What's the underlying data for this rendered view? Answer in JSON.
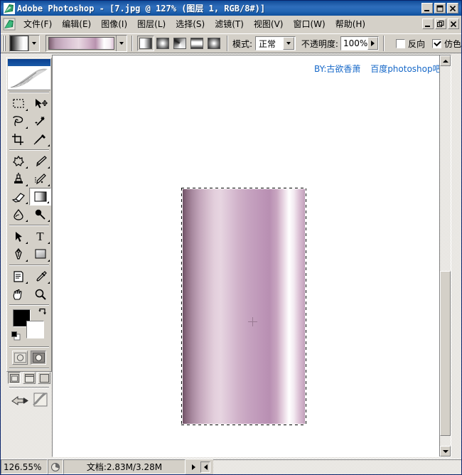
{
  "window": {
    "app_name": "Adobe Photoshop",
    "title": "Adobe Photoshop - [7.jpg @ 127% (图层 1, RGB/8#)]",
    "document_name": "7.jpg",
    "document_zoom_label": "127%",
    "layer_label": "图层 1",
    "color_mode_label": "RGB/8#",
    "app_icon": "photoshop-feather-icon",
    "controls": {
      "minimize": "_",
      "restore": "❐",
      "close": "✕"
    },
    "mdi_controls": {
      "minimize": "_",
      "restore": "❐",
      "close": "✕"
    }
  },
  "menubar": {
    "items": [
      {
        "label": "文件(F)",
        "name": "menu-file"
      },
      {
        "label": "编辑(E)",
        "name": "menu-edit"
      },
      {
        "label": "图像(I)",
        "name": "menu-image"
      },
      {
        "label": "图层(L)",
        "name": "menu-layer"
      },
      {
        "label": "选择(S)",
        "name": "menu-select"
      },
      {
        "label": "滤镜(T)",
        "name": "menu-filter"
      },
      {
        "label": "视图(V)",
        "name": "menu-view"
      },
      {
        "label": "窗口(W)",
        "name": "menu-window"
      },
      {
        "label": "帮助(H)",
        "name": "menu-help"
      }
    ]
  },
  "options_bar": {
    "tool_preset_name": "gradient-tool-preset",
    "gradient_preset_name": "pink-white-gradient",
    "gradient_types": [
      {
        "name": "linear-gradient-button",
        "selected": true
      },
      {
        "name": "radial-gradient-button",
        "selected": false
      },
      {
        "name": "angle-gradient-button",
        "selected": false
      },
      {
        "name": "reflected-gradient-button",
        "selected": false
      },
      {
        "name": "diamond-gradient-button",
        "selected": false
      }
    ],
    "mode_label": "模式:",
    "mode_value": "正常",
    "opacity_label": "不透明度:",
    "opacity_value": "100%",
    "reverse_label": "反向",
    "reverse_checked": false,
    "dither_label": "仿色",
    "dither_checked": true
  },
  "toolbox": {
    "tools": [
      {
        "name": "rectangular-marquee-tool",
        "icon": "marquee-icon",
        "selected": false,
        "has_flyout": true
      },
      {
        "name": "move-tool",
        "icon": "move-icon",
        "selected": false,
        "has_flyout": false
      },
      {
        "name": "lasso-tool",
        "icon": "lasso-icon",
        "selected": false,
        "has_flyout": true
      },
      {
        "name": "magic-wand-tool",
        "icon": "magic-wand-icon",
        "selected": false,
        "has_flyout": false
      },
      {
        "name": "crop-tool",
        "icon": "crop-icon",
        "selected": false,
        "has_flyout": false
      },
      {
        "name": "slice-tool",
        "icon": "slice-icon",
        "selected": false,
        "has_flyout": true
      },
      {
        "name": "healing-brush-tool",
        "icon": "healing-brush-icon",
        "selected": false,
        "has_flyout": true
      },
      {
        "name": "brush-tool",
        "icon": "brush-icon",
        "selected": false,
        "has_flyout": true
      },
      {
        "name": "clone-stamp-tool",
        "icon": "stamp-icon",
        "selected": false,
        "has_flyout": true
      },
      {
        "name": "history-brush-tool",
        "icon": "history-brush-icon",
        "selected": false,
        "has_flyout": true
      },
      {
        "name": "eraser-tool",
        "icon": "eraser-icon",
        "selected": false,
        "has_flyout": true
      },
      {
        "name": "gradient-tool",
        "icon": "gradient-icon",
        "selected": true,
        "has_flyout": true
      },
      {
        "name": "blur-tool",
        "icon": "blur-drop-icon",
        "selected": false,
        "has_flyout": true
      },
      {
        "name": "dodge-tool",
        "icon": "dodge-icon",
        "selected": false,
        "has_flyout": true
      },
      {
        "name": "path-selection-tool",
        "icon": "path-arrow-icon",
        "selected": false,
        "has_flyout": true
      },
      {
        "name": "type-tool",
        "icon": "type-t-icon",
        "selected": false,
        "has_flyout": true
      },
      {
        "name": "pen-tool",
        "icon": "pen-icon",
        "selected": false,
        "has_flyout": true
      },
      {
        "name": "shape-tool",
        "icon": "rectangle-shape-icon",
        "selected": false,
        "has_flyout": true
      },
      {
        "name": "notes-tool",
        "icon": "notes-icon",
        "selected": false,
        "has_flyout": true
      },
      {
        "name": "eyedropper-tool",
        "icon": "eyedropper-icon",
        "selected": false,
        "has_flyout": true
      },
      {
        "name": "hand-tool",
        "icon": "hand-icon",
        "selected": false,
        "has_flyout": false
      },
      {
        "name": "zoom-tool",
        "icon": "magnifier-icon",
        "selected": false,
        "has_flyout": false
      }
    ],
    "foreground_color": "#000000",
    "background_color": "#ffffff",
    "swap_colors_name": "swap-colors-icon",
    "default_colors_name": "default-colors-icon",
    "quickmask": [
      {
        "name": "standard-mode-button",
        "active": false
      },
      {
        "name": "quick-mask-mode-button",
        "active": true
      }
    ],
    "screenmodes": [
      {
        "name": "standard-screen-mode-button",
        "active": true
      },
      {
        "name": "full-screen-with-menubar-button",
        "active": false
      },
      {
        "name": "full-screen-mode-button",
        "active": false
      }
    ],
    "jump_to": [
      {
        "name": "jump-to-imageready-button"
      },
      {
        "name": "jump-to-other-app-button"
      }
    ]
  },
  "canvas": {
    "watermark_author": "BY:古欲香萧",
    "watermark_site": "百度photoshop吧",
    "watermark_color": "#1668c8",
    "selection_present": true,
    "cursor_name": "crosshair-cursor",
    "gradient_fill_description": "vertical pink-to-white metallic linear gradient"
  },
  "statusbar": {
    "zoom_value": "126.55%",
    "preview_icon": "thumbnail-icon",
    "doc_info": "文档:2.83M/3.28M",
    "next_arrow": "▶",
    "prev_arrow": "◀"
  }
}
